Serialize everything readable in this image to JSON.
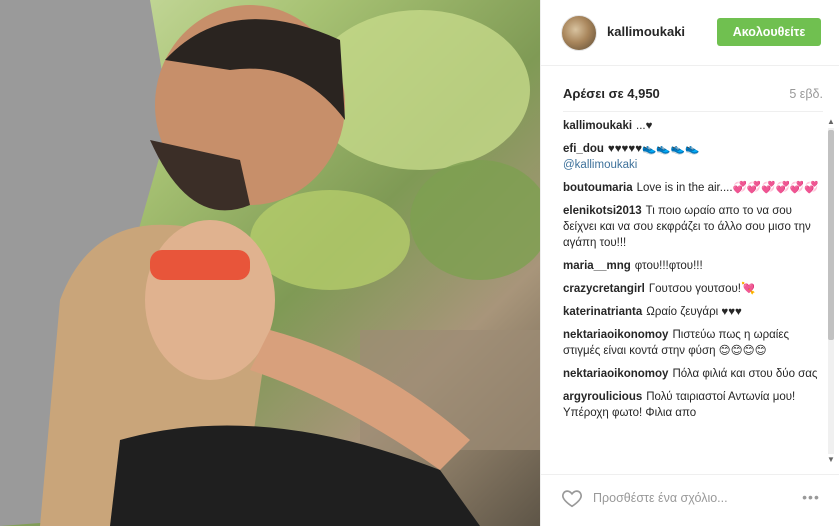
{
  "post": {
    "username": "kallimoukaki",
    "follow_label": "Ακολουθείτε",
    "likes_text": "Αρέσει σε 4,950",
    "time_ago": "5 εβδ."
  },
  "comments": [
    {
      "user": "kallimoukaki",
      "text": "...♥"
    },
    {
      "user": "efi_dou",
      "text": "♥♥♥♥♥👟👟👟👟",
      "mention": "@kallimoukaki"
    },
    {
      "user": "boutoumaria",
      "text": "Love is in the air....💞💞💞💞💞💞"
    },
    {
      "user": "elenikotsi2013",
      "text": "Τι ποιο ωραίο απο το να σου δείχνει και να σου εκφράζει το άλλο σου μισο την αγάπη του!!!"
    },
    {
      "user": "maria__mng",
      "text": "φτου!!!φτου!!!"
    },
    {
      "user": "crazycretangirl",
      "text": "Γουτσου γουτσου!💘"
    },
    {
      "user": "katerinatrianta",
      "text": "Ωραίο ζευγάρι ♥♥♥"
    },
    {
      "user": "nektariaoikonomoy",
      "text": "Πιστεύω πως η ωραίες στιγμές είναι κοντά στην φύση 😊😊😊😊"
    },
    {
      "user": "nektariaoikonomoy",
      "text": "Πόλα φιλιά και στου δύο σας"
    },
    {
      "user": "argyroulicious",
      "text": "Πολύ ταιριαστοί Αντωνία μου! Υπέροχη φωτο! Φιλια απο"
    }
  ],
  "footer": {
    "comment_placeholder": "Προσθέστε ένα σχόλιο...",
    "more_label": "•••"
  },
  "icons": {
    "like": "heart-icon",
    "more": "more-options-icon",
    "scroll_up": "scroll-up-icon",
    "scroll_down": "scroll-down-icon"
  },
  "colors": {
    "follow_button": "#70c050",
    "mention": "#3f729b",
    "muted_text": "#999999"
  }
}
